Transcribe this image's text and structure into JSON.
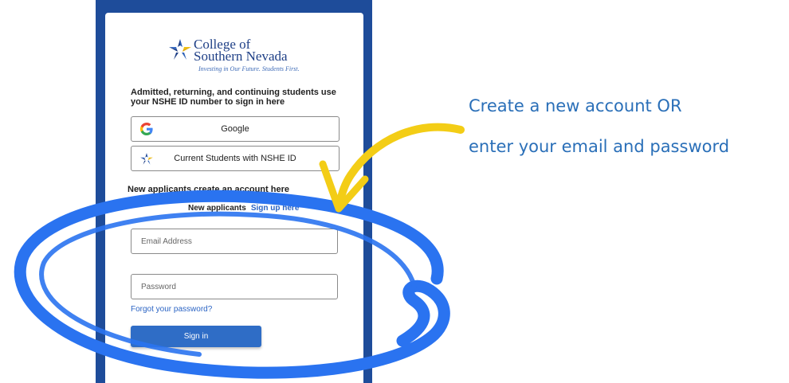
{
  "logo": {
    "line1": "College of",
    "line2": "Southern Nevada",
    "tagline": "Investing in Our Future. Students First."
  },
  "intro_text": "Admitted, returning, and continuing students use your NSHE ID number to sign in here",
  "providers": {
    "google_label": "Google",
    "nshe_label": "Current Students with NSHE ID"
  },
  "new_applicants": {
    "heading": "New applicants create an account here",
    "prompt": "New applicants",
    "signup_link": "Sign up here"
  },
  "form": {
    "email_placeholder": "Email Address",
    "password_placeholder": "Password",
    "forgot_link": "Forgot your password?",
    "signin_label": "Sign in"
  },
  "callout": {
    "line1": "Create a new account OR",
    "line2": "enter your email and password"
  },
  "colors": {
    "frame": "#1e4c9a",
    "accent": "#2f6dc6",
    "callout_text": "#2a6fb8",
    "arrow": "#f3cd16",
    "ellipse": "#2a73f0"
  },
  "icons": {
    "logo": "csn-star-icon",
    "google": "google-icon",
    "nshe": "csn-star-icon"
  }
}
